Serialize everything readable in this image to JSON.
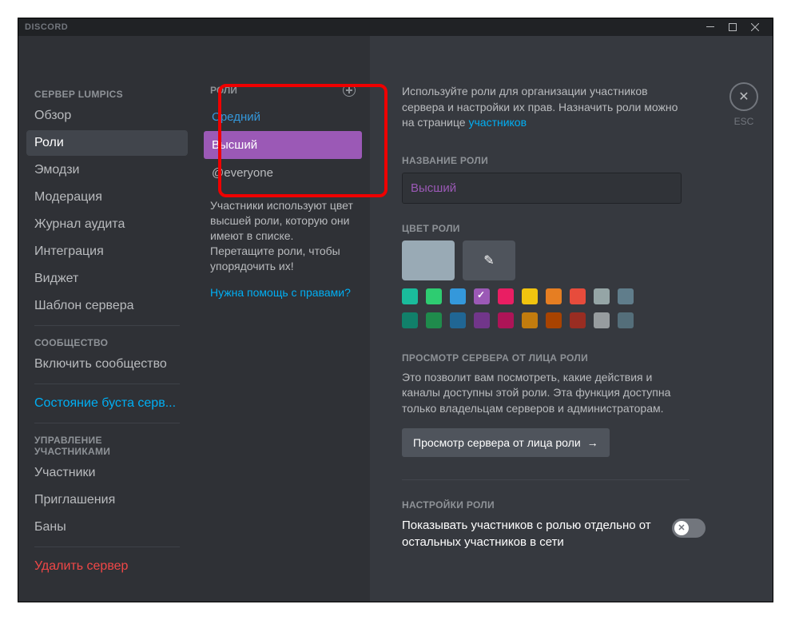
{
  "titlebar": {
    "brand": "DISCORD"
  },
  "sidebar": {
    "server_header": "СЕРВЕР LUMPICS",
    "items_a": [
      "Обзор",
      "Роли",
      "Эмодзи",
      "Модерация",
      "Журнал аудита",
      "Интеграция",
      "Виджет",
      "Шаблон сервера"
    ],
    "community_header": "СООБЩЕСТВО",
    "community_item": "Включить сообщество",
    "boost_status": "Состояние буста серв...",
    "members_header": "УПРАВЛЕНИЕ УЧАСТНИКАМИ",
    "members_items": [
      "Участники",
      "Приглашения",
      "Баны"
    ],
    "delete": "Удалить сервер"
  },
  "roles_panel": {
    "header": "РОЛИ",
    "items": [
      {
        "label": "Средний",
        "cls": "r-blue"
      },
      {
        "label": "Высший",
        "cls": "r-purple"
      },
      {
        "label": "@everyone",
        "cls": "r-grey"
      }
    ],
    "help": "Участники используют цвет высшей роли, которую они имеют в списке. Перетащите роли, чтобы упорядочить их!",
    "help_link": "Нужна помощь с правами?"
  },
  "main": {
    "intro_pre": "Используйте роли для организации участников сервера и настройки их прав. Назначить роли можно на странице ",
    "intro_link": "участников",
    "name_label": "НАЗВАНИЕ РОЛИ",
    "name_value": "Высший",
    "color_label": "ЦВЕТ РОЛИ",
    "default_color": "#99aab5",
    "custom_color": "#4f545c",
    "row1": [
      "#1abc9c",
      "#2ecc71",
      "#3498db",
      "#9b59b6",
      "#e91e63",
      "#f1c40f",
      "#e67e22",
      "#e74c3c",
      "#95a5a6",
      "#607d8b"
    ],
    "row2": [
      "#11806a",
      "#1f8b4c",
      "#206694",
      "#71368a",
      "#ad1457",
      "#c27c0e",
      "#a84300",
      "#992d22",
      "#979c9f",
      "#546e7a"
    ],
    "selected_color_index": 3,
    "preview_label": "ПРОСМОТР СЕРВЕРА ОТ ЛИЦА РОЛИ",
    "preview_desc": "Это позволит вам посмотреть, какие действия и каналы доступны этой роли. Эта функция доступна только владельцам серверов и администраторам.",
    "preview_btn": "Просмотр сервера от лица роли",
    "settings_label": "НАСТРОЙКИ РОЛИ",
    "toggle_label": "Показывать участников с ролью отдельно от остальных участников в сети",
    "esc": "ESC"
  }
}
